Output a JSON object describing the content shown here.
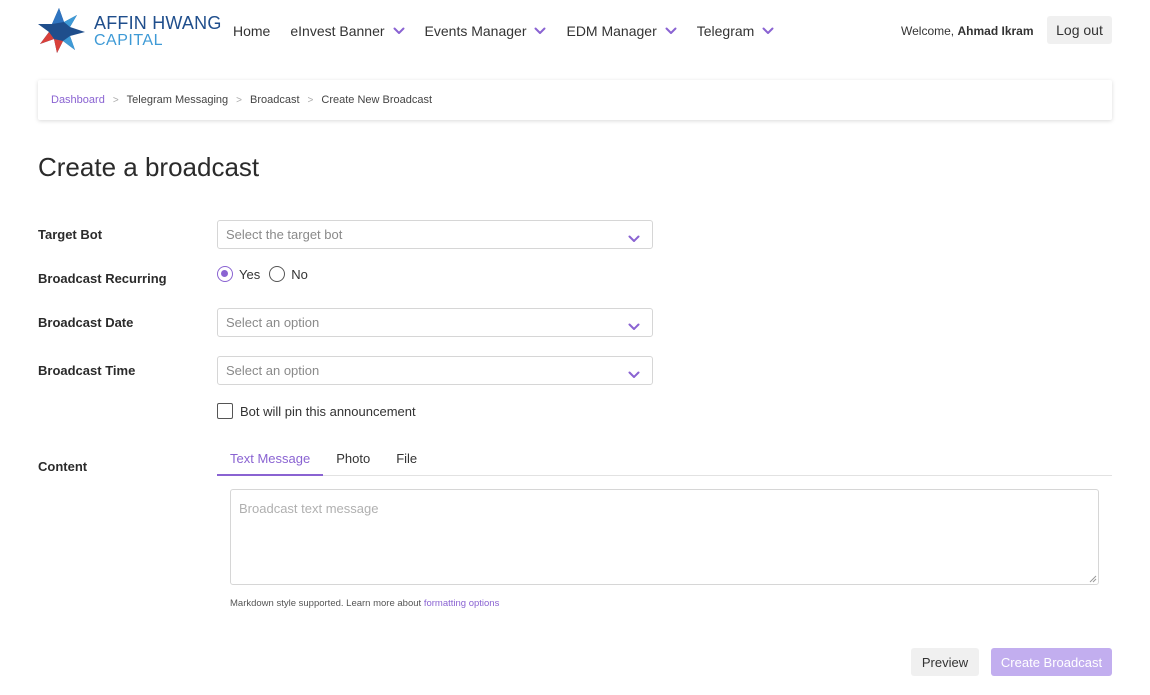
{
  "brand": {
    "line1": "AFFIN HWANG",
    "line2": "CAPITAL",
    "colors": {
      "navy": "#1f4e8c",
      "blue": "#3e9ad6",
      "red": "#d9403a"
    }
  },
  "nav": {
    "items": [
      {
        "label": "Home",
        "has_dropdown": false
      },
      {
        "label": "eInvest Banner",
        "has_dropdown": true
      },
      {
        "label": "Events Manager",
        "has_dropdown": true
      },
      {
        "label": "EDM Manager",
        "has_dropdown": true
      },
      {
        "label": "Telegram",
        "has_dropdown": true
      }
    ],
    "welcome_prefix": "Welcome,",
    "user_name": "Ahmad Ikram",
    "logout_label": "Log out"
  },
  "breadcrumb": {
    "items": [
      "Dashboard",
      "Telegram Messaging",
      "Broadcast",
      "Create New Broadcast"
    ],
    "separator": ">"
  },
  "page_title": "Create a broadcast",
  "form": {
    "target_bot": {
      "label": "Target Bot",
      "placeholder": "Select the target bot"
    },
    "recurring": {
      "label": "Broadcast Recurring",
      "options": [
        "Yes",
        "No"
      ],
      "selected": "Yes"
    },
    "date": {
      "label": "Broadcast Date",
      "placeholder": "Select an option"
    },
    "time": {
      "label": "Broadcast Time",
      "placeholder": "Select an option"
    },
    "pin": {
      "label": "Bot will pin this announcement",
      "checked": false
    },
    "content": {
      "label": "Content",
      "tabs": [
        "Text Message",
        "Photo",
        "File"
      ],
      "active_tab": "Text Message",
      "placeholder": "Broadcast text message",
      "help_text": "Markdown style supported. Learn more about",
      "help_link": "formatting options"
    }
  },
  "actions": {
    "preview_label": "Preview",
    "create_label": "Create Broadcast"
  },
  "accent_color": "#8a63d2"
}
